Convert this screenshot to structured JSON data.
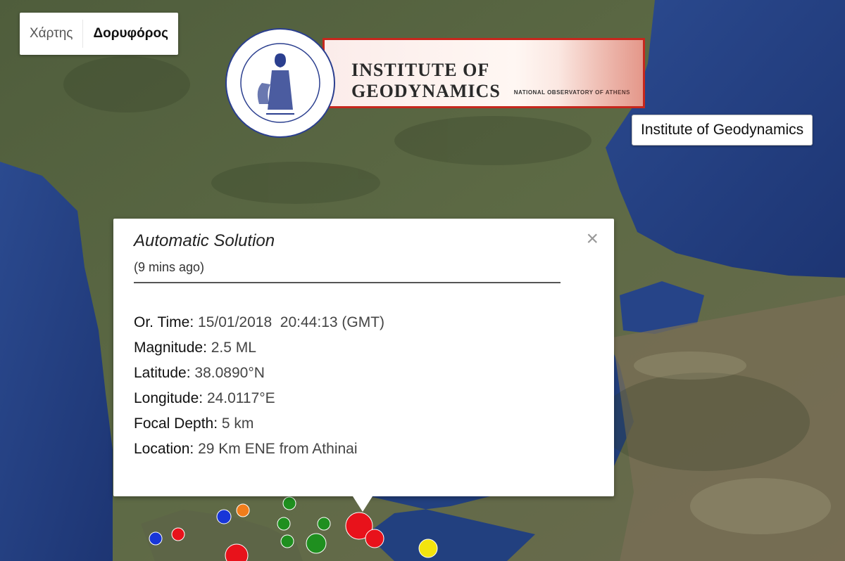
{
  "map_type": {
    "map_label": "Χάρτης",
    "satellite_label": "Δορυφόρος",
    "selected": "Δορυφόρος"
  },
  "logo": {
    "title": "INSTITUTE OF GEODYNAMICS",
    "subtitle": "NATIONAL OBSERVATORY OF ATHENS",
    "seal_text": "NATIONAL OBSERVATORY OF ATHENS"
  },
  "tooltip": {
    "text": "Institute of Geodynamics"
  },
  "info_window": {
    "heading": "Automatic Solution",
    "time_ago": "(9 mins ago)",
    "close_symbol": "×",
    "rows": [
      {
        "key": "Or. Time:",
        "value": "15/01/2018  20:44:13 (GMT)"
      },
      {
        "key": "Magnitude:",
        "value": "2.5 ML"
      },
      {
        "key": "Latitude:",
        "value": "38.0890°N"
      },
      {
        "key": "Longitude:",
        "value": "24.0117°E"
      },
      {
        "key": "Focal Depth:",
        "value": "5 km"
      },
      {
        "key": "Location:",
        "value": "29 Km ENE from Athinai"
      }
    ]
  },
  "marker_colors": {
    "red": "#e8121b",
    "green": "#1f8f1f",
    "orange": "#f07d1c",
    "blue": "#1836d8",
    "yellow": "#f3e40e"
  }
}
